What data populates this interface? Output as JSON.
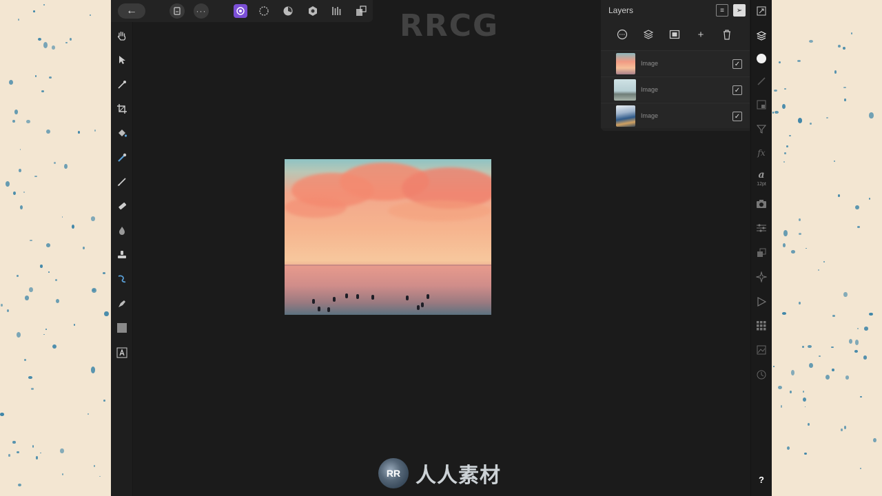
{
  "watermark": {
    "top_text": "RRCG",
    "logo_text": "人人素材",
    "logo_badge": "RR"
  },
  "toolbar": {
    "back_icon": "arrow-left-icon",
    "document_icon": "document-icon",
    "more_icon": "ellipsis-icon",
    "personas": [
      "photo-persona-icon",
      "liquify-persona-icon",
      "develop-persona-icon",
      "tone-mapping-persona-icon",
      "export-persona-icon"
    ],
    "last_icon": "arrange-icon"
  },
  "tools": [
    "hand-icon",
    "move-icon",
    "color-picker-icon",
    "crop-icon",
    "flood-fill-icon",
    "selection-brush-icon",
    "paint-brush-icon",
    "erase-brush-icon",
    "dodge-burn-icon",
    "clone-icon",
    "smudge-icon",
    "pen-icon",
    "rectangle-icon",
    "text-icon"
  ],
  "layers_panel": {
    "title": "Layers",
    "actions": [
      "blend-modes-icon",
      "layer-stack-icon",
      "mask-icon",
      "add-layer-icon",
      "delete-layer-icon"
    ],
    "add_label": "+",
    "layers": [
      {
        "name": "Image",
        "visible": true,
        "check": "✓",
        "thumb": "sunset-sea"
      },
      {
        "name": "Image",
        "visible": true,
        "check": "✓",
        "thumb": "misty-coast"
      },
      {
        "name": "Image",
        "visible": true,
        "check": "✓",
        "thumb": "wave"
      }
    ]
  },
  "studio": {
    "icons": [
      "layers-icon",
      "color-icon",
      "brushes-icon",
      "adjustments-icon",
      "filters-icon",
      "effects-icon",
      "character-icon",
      "camera-icon",
      "tone-icon",
      "transform-icon",
      "navigator-icon",
      "play-icon",
      "grid-icon",
      "stock-icon",
      "history-icon"
    ],
    "fx_label": "fx",
    "character_label": "a",
    "font_size_label": "12pt",
    "help_label": "?"
  }
}
